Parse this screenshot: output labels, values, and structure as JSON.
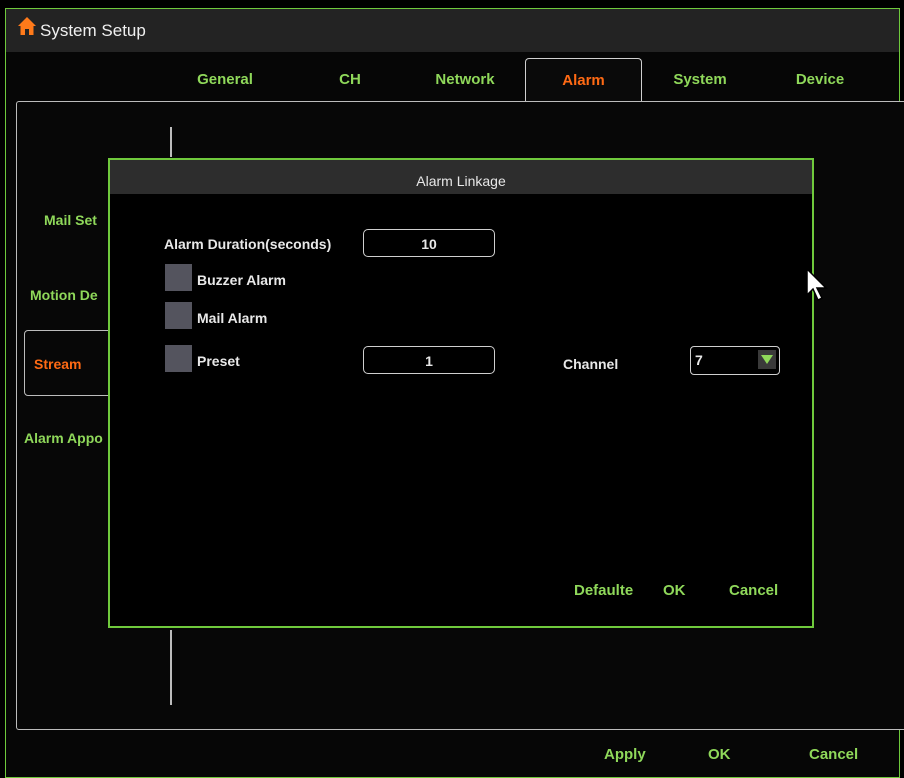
{
  "window": {
    "title": "System Setup"
  },
  "tabs": [
    {
      "label": "General"
    },
    {
      "label": "CH"
    },
    {
      "label": "Network"
    },
    {
      "label": "Alarm",
      "active": true
    },
    {
      "label": "System"
    },
    {
      "label": "Device"
    }
  ],
  "sidebar": {
    "items": [
      {
        "label": "Mail Set"
      },
      {
        "label": "Motion De"
      },
      {
        "label": "Stream",
        "active": true
      },
      {
        "label": "Alarm Appo"
      }
    ]
  },
  "dialog": {
    "title": "Alarm Linkage",
    "alarm_duration_label": "Alarm Duration(seconds)",
    "alarm_duration_value": "10",
    "buzzer_alarm_label": "Buzzer Alarm",
    "mail_alarm_label": "Mail Alarm",
    "preset_label": "Preset",
    "preset_value": "1",
    "channel_label": "Channel",
    "channel_value": "7",
    "default_label": "Defaulte",
    "ok_label": "OK",
    "cancel_label": "Cancel"
  },
  "footer": {
    "apply_label": "Apply",
    "ok_label": "OK",
    "cancel_label": "Cancel"
  },
  "colors": {
    "accent_green": "#8fd85a",
    "active_orange": "#ff6a14",
    "border_green": "#6fc93c"
  },
  "icons": {
    "home": "home-icon",
    "dropdown": "triangle-down-icon",
    "cursor": "mouse-pointer-icon"
  }
}
